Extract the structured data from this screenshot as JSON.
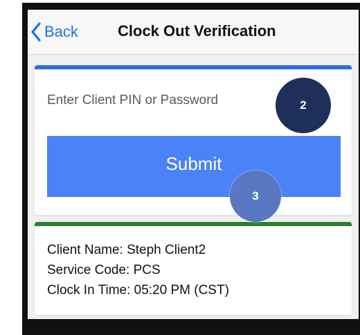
{
  "navbar": {
    "back_label": "Back",
    "title": "Clock Out Verification"
  },
  "pin_form": {
    "placeholder": "Enter Client PIN or Password",
    "submit_label": "Submit",
    "accent_color": "#2f6fde"
  },
  "client_info": {
    "name_line": "Client Name: Steph Client2",
    "service_code_line": "Service Code: PCS",
    "clock_in_line": "Clock In Time: 05:20 PM (CST)",
    "accent_color": "#2a7f2e"
  },
  "step_markers": [
    {
      "label": "2"
    },
    {
      "label": "3"
    }
  ]
}
